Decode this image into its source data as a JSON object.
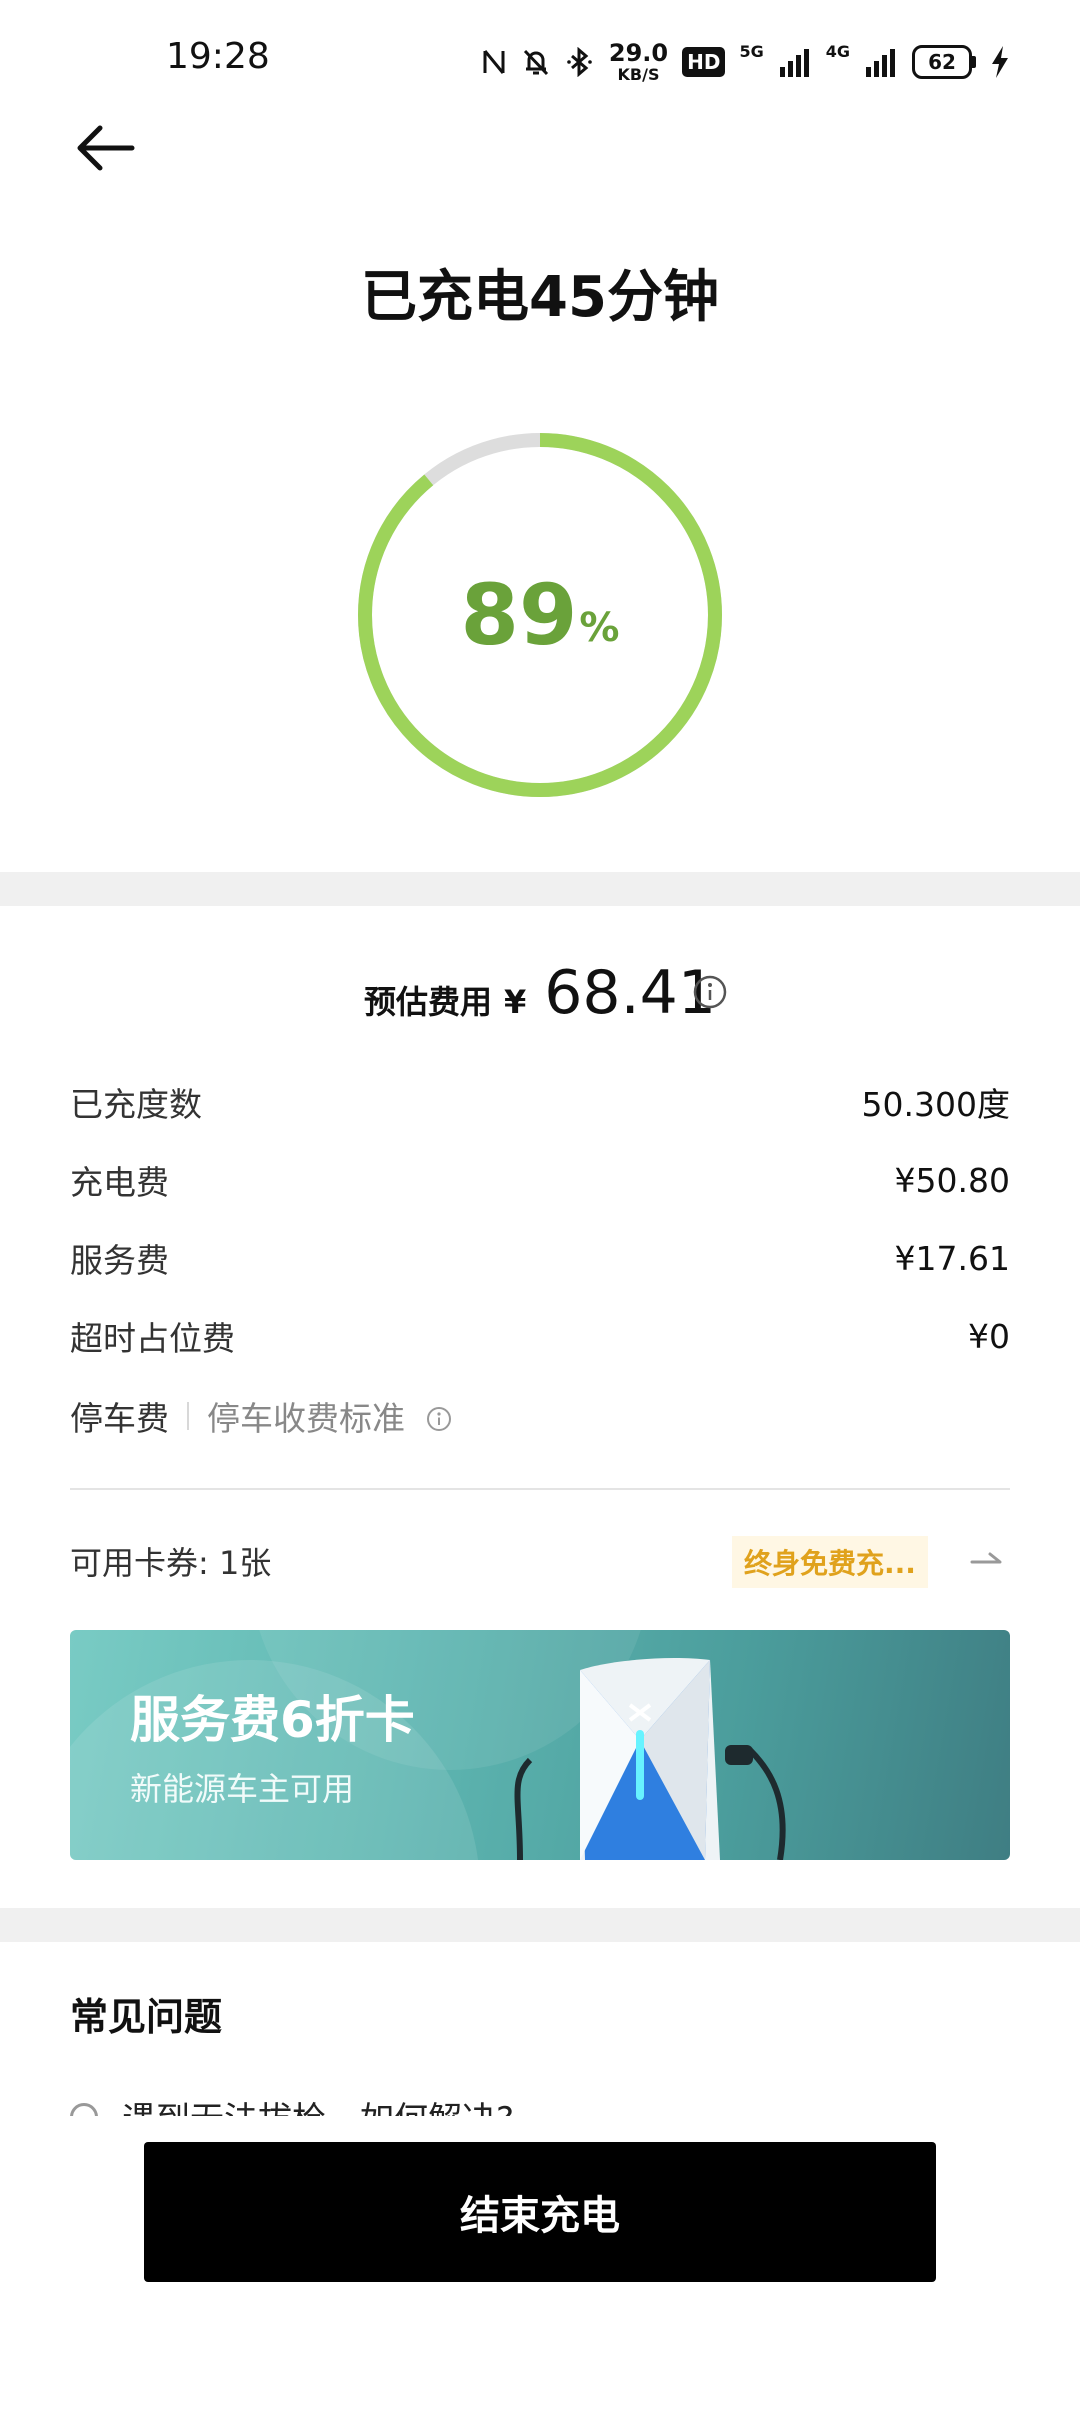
{
  "status_bar": {
    "time": "19:28",
    "speed_value": "29.0",
    "speed_unit": "KB/S",
    "hd_label": "HD",
    "net1": "5G",
    "net2": "4G",
    "battery": "62",
    "icons": [
      "nfc-icon",
      "bell-off-icon",
      "bluetooth-icon",
      "signal-icon",
      "battery-icon",
      "charging-bolt-icon"
    ]
  },
  "header": {
    "title": "已充电45分钟"
  },
  "progress": {
    "value": 89,
    "number": "89",
    "unit": "%",
    "arc_color": "#9dd35a",
    "track_color": "#dddddd",
    "text_color": "#6aa23a"
  },
  "estimate": {
    "label": "预估费用",
    "currency": "¥",
    "amount": "68.41"
  },
  "details": [
    {
      "label": "已充度数",
      "value": "50.300度"
    },
    {
      "label": "充电费",
      "value": "¥50.80"
    },
    {
      "label": "服务费",
      "value": "¥17.61"
    },
    {
      "label": "超时占位费",
      "value": "¥0"
    }
  ],
  "parking": {
    "label": "停车费",
    "link": "停车收费标准"
  },
  "coupon": {
    "label": "可用卡券: 1张",
    "tag": "终身免费充..."
  },
  "banner": {
    "title": "服务费6折卡",
    "subtitle": "新能源车主可用"
  },
  "faq": {
    "title": "常见问题",
    "first_item": "遇到无法拔枪，如何解决?"
  },
  "footer": {
    "end_button": "结束充电"
  }
}
